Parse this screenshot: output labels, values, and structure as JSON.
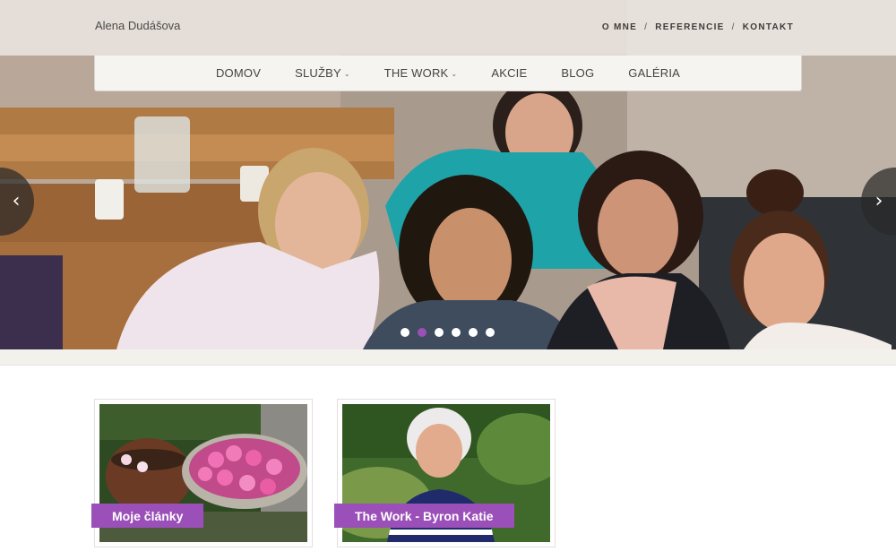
{
  "header": {
    "site_name": "Alena Dudášova",
    "top_links": [
      "O MNE",
      "REFERENCIE",
      "KONTAKT"
    ],
    "separator": "/"
  },
  "nav": {
    "items": [
      {
        "label": "DOMOV",
        "dropdown": false
      },
      {
        "label": "SLUŽBY",
        "dropdown": true
      },
      {
        "label": "THE WORK",
        "dropdown": true
      },
      {
        "label": "AKCIE",
        "dropdown": false
      },
      {
        "label": "BLOG",
        "dropdown": false
      },
      {
        "label": "GALÉRIA",
        "dropdown": false
      }
    ],
    "chevron": "⌄"
  },
  "slider": {
    "prev_glyph": "‹",
    "next_glyph": "›",
    "slide_count": 6,
    "active_slide": 2
  },
  "cards": [
    {
      "label": "Moje články",
      "image": "pink-flowers-bowl"
    },
    {
      "label": "The Work - Byron Katie",
      "image": "woman-portrait"
    }
  ],
  "colors": {
    "accent": "#9b4fb8",
    "nav_bg": "#f6f4f1",
    "band_bg": "#f3f1ec"
  }
}
